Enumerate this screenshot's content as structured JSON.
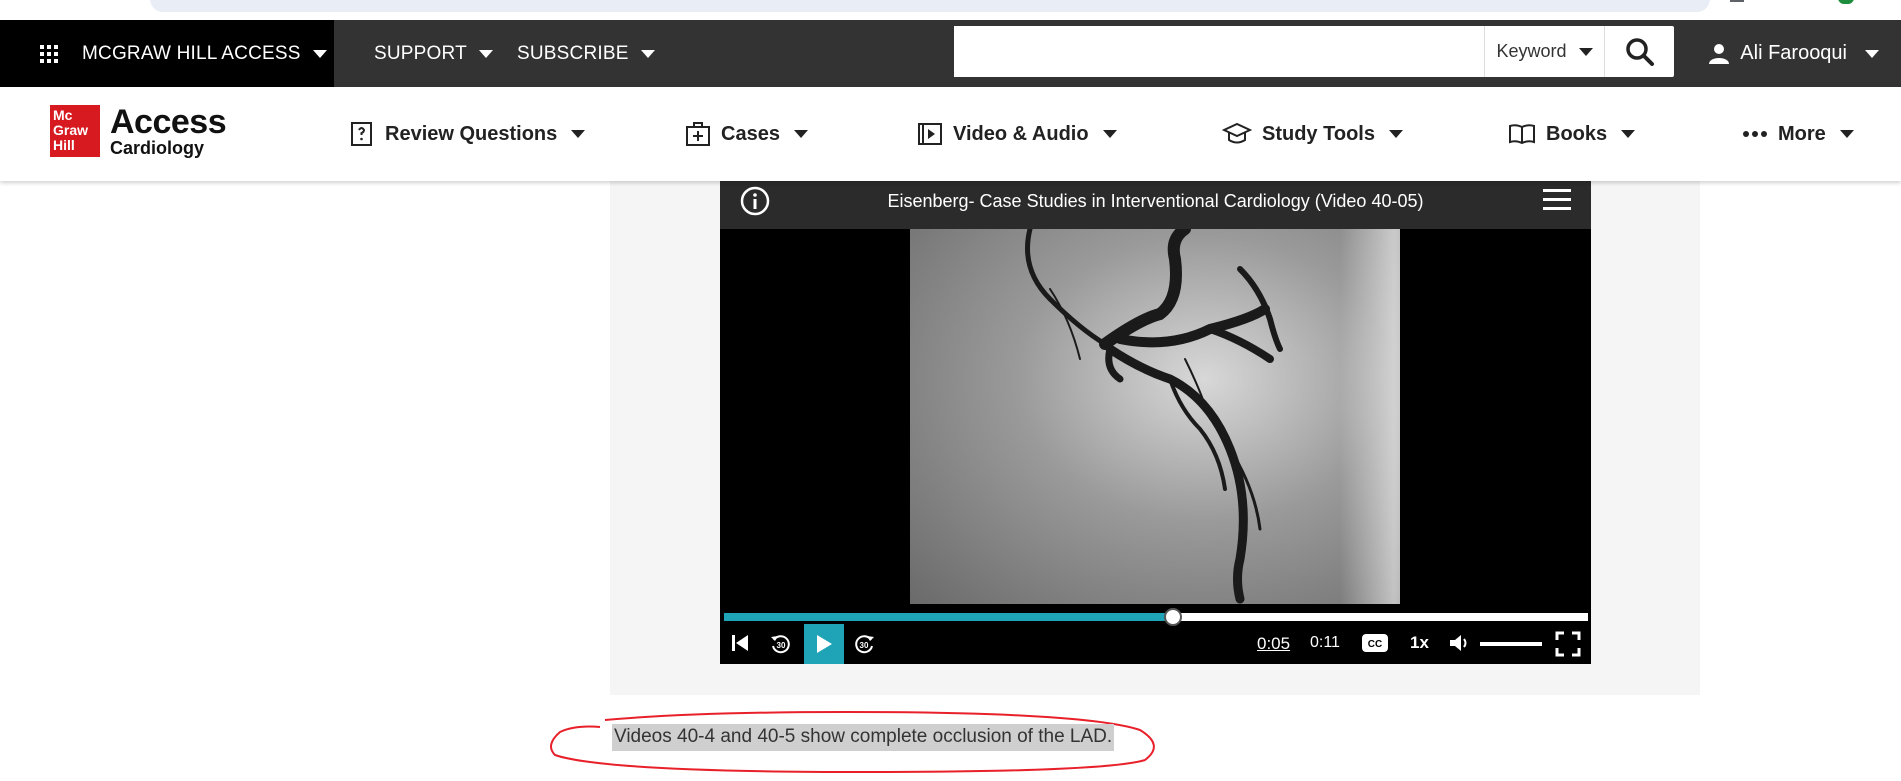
{
  "brand": {
    "label": "MCGRAW HILL ACCESS",
    "logo_small": "Mc Graw Hill",
    "logo_title": "Access",
    "logo_sub": "Cardiology"
  },
  "topnav": {
    "support": "SUPPORT",
    "subscribe": "SUBSCRIBE"
  },
  "search": {
    "value": "",
    "placeholder": "",
    "scope": "Keyword"
  },
  "user": {
    "name": "Ali Farooqui"
  },
  "productnav": {
    "items": [
      {
        "label": "Review Questions",
        "icon": "question-book-icon"
      },
      {
        "label": "Cases",
        "icon": "medkit-icon"
      },
      {
        "label": "Video & Audio",
        "icon": "video-icon"
      },
      {
        "label": "Study Tools",
        "icon": "graduation-cap-icon"
      },
      {
        "label": "Books",
        "icon": "open-book-icon"
      },
      {
        "label": "More",
        "icon": "ellipsis-icon"
      }
    ]
  },
  "player": {
    "title": "Eisenberg- Case Studies in Interventional Cardiology (Video 40-05)",
    "current_time": "0:05",
    "duration": "0:11",
    "progress_fraction": 0.52,
    "speed": "1x",
    "cc_label": "CC",
    "skip_back_label": "30",
    "skip_fwd_label": "30",
    "accent_color": "#1fa3b6"
  },
  "caption": {
    "text": "Videos 40-4 and 40-5 show complete occlusion of the LAD."
  },
  "colors": {
    "topbar": "#333333",
    "brand_bg": "#000000",
    "logo_red": "#d71920",
    "annotation": "#e8202a"
  }
}
